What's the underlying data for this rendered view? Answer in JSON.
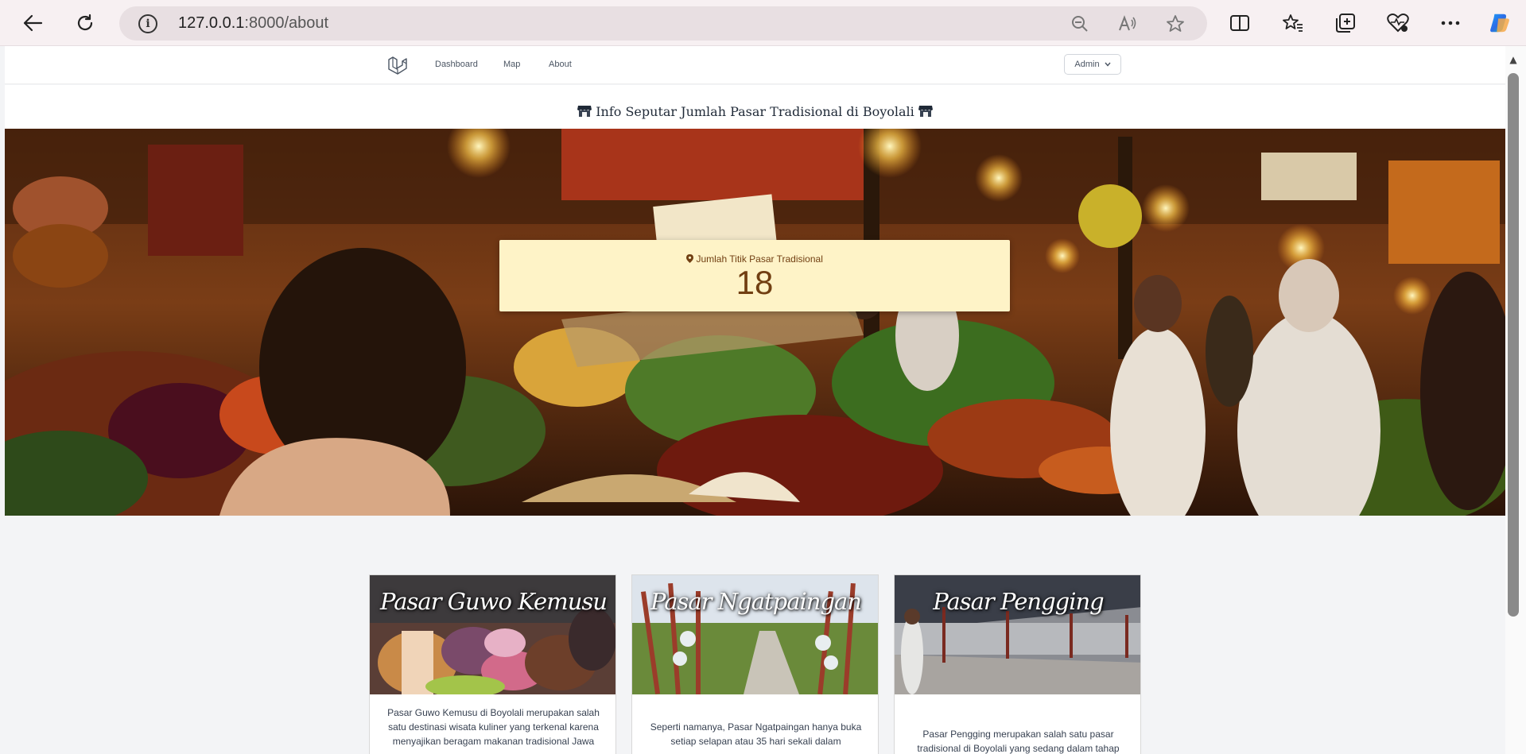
{
  "browser": {
    "url_host": "127.0.0.1",
    "url_rest": ":8000/about"
  },
  "nav": {
    "links": [
      "Dashboard",
      "Map",
      "About"
    ],
    "user_menu": "Admin"
  },
  "page": {
    "title": "Info Seputar Jumlah Pasar Tradisional di Boyolali"
  },
  "stat": {
    "label": "Jumlah Titik Pasar Tradisional",
    "value": "18"
  },
  "cards": [
    {
      "title": "Pasar Guwo Kemusu",
      "lines": [
        "Pasar Guwo Kemusu di Boyolali merupakan salah",
        "satu destinasi wisata kuliner yang terkenal karena",
        "menyajikan beragam makanan tradisional Jawa"
      ]
    },
    {
      "title": "Pasar Ngatpaingan",
      "lines": [
        "Seperti namanya, Pasar Ngatpaingan hanya buka",
        "setiap selapan atau 35 hari sekali dalam"
      ]
    },
    {
      "title": "Pasar Pengging",
      "lines": [
        "Pasar Pengging merupakan salah satu pasar",
        "tradisional di Boyolali yang sedang dalam tahap"
      ]
    }
  ],
  "colors": {
    "stat_bg": "#fef3c7",
    "stat_text": "#713f12"
  }
}
